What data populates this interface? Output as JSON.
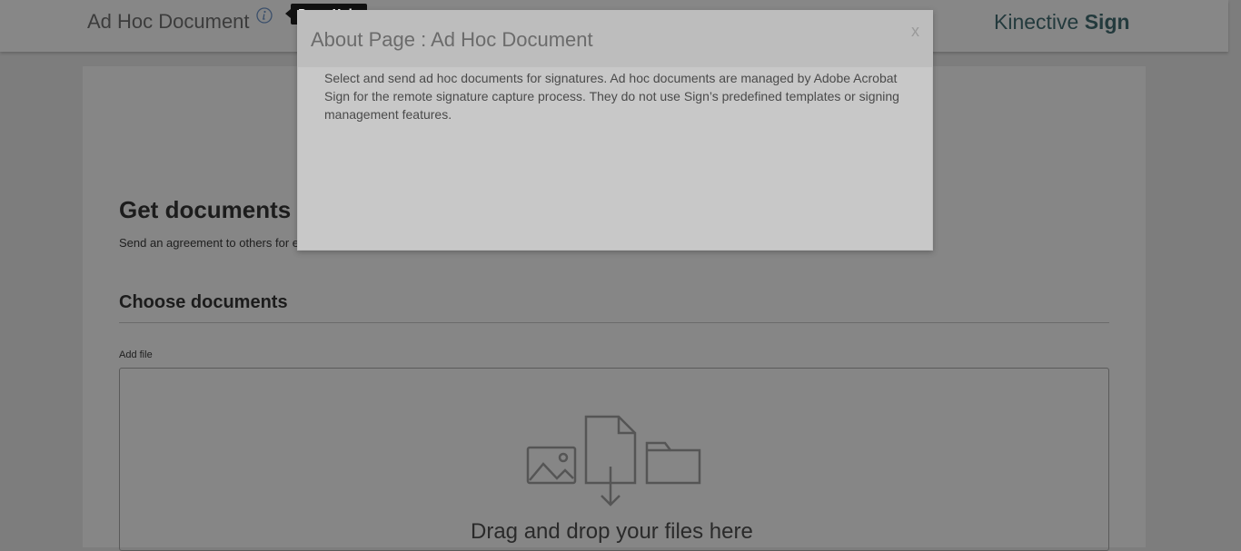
{
  "header": {
    "page_title": "Ad Hoc Document",
    "info_icon": "info-icon",
    "tooltip": "Page Help",
    "brand_light": "Kinective ",
    "brand_bold": "Sign"
  },
  "main": {
    "heading": "Get documents signed",
    "subtitle": "Send an agreement to others for e-signing, approval, or other processing.",
    "section_heading": "Choose documents",
    "add_file_label": "Add file",
    "drop_text": "Drag and drop your files here"
  },
  "modal": {
    "title": "About Page : Ad Hoc Document",
    "close_label": "x",
    "body": "Select and send ad hoc documents for signatures. Ad hoc documents are managed by Adobe Acrobat Sign for the remote signature capture process. They do not use Sign’s predefined templates or signing management features."
  },
  "colors": {
    "overlay_bg": "#7d7d7d",
    "modal_bg": "#c8c8c8",
    "brand": "#233a3d"
  }
}
